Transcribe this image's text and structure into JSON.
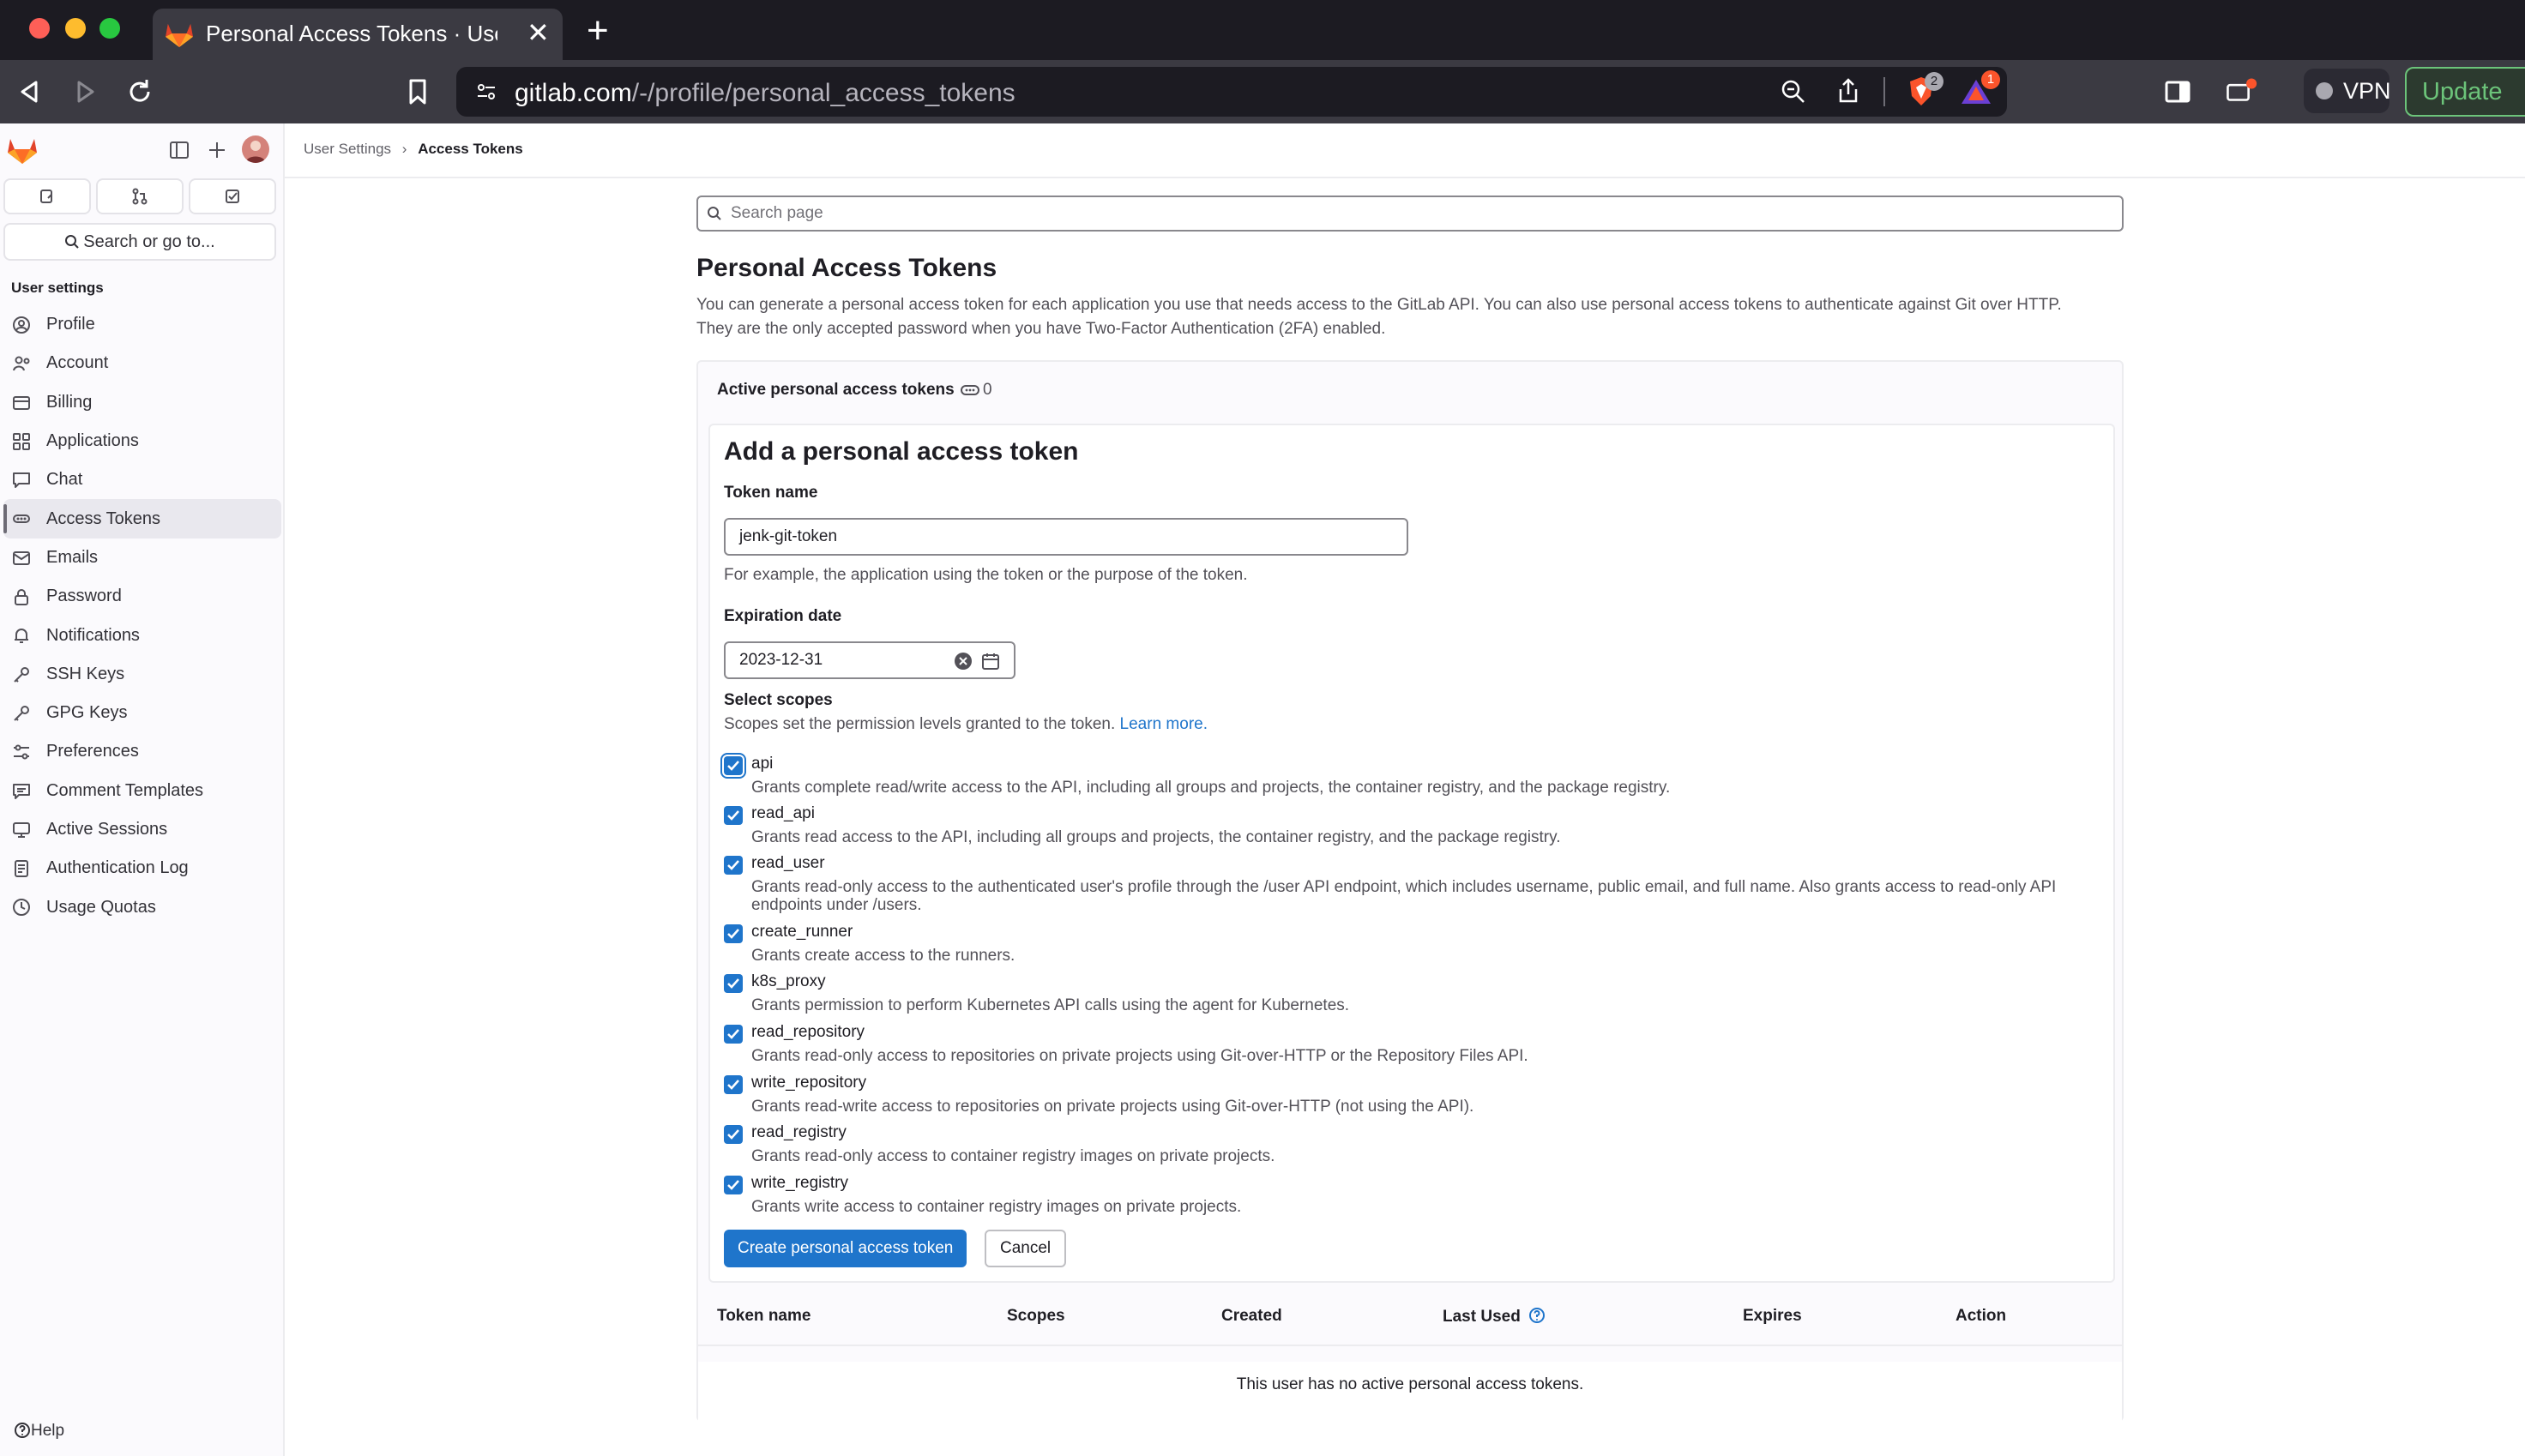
{
  "browser": {
    "tab_title": "Personal Access Tokens · User Settings · GitLab",
    "url_host": "gitlab.com",
    "url_path": "/-/profile/personal_access_tokens",
    "brave_badge": "2",
    "alert_badge": "1",
    "vpn_label": "VPN",
    "update_label": "Update"
  },
  "sidebar": {
    "section_title": "User settings",
    "search_label": "Search or go to...",
    "items": [
      {
        "label": "Profile",
        "icon": "profile-icon"
      },
      {
        "label": "Account",
        "icon": "account-icon"
      },
      {
        "label": "Billing",
        "icon": "billing-icon"
      },
      {
        "label": "Applications",
        "icon": "applications-icon"
      },
      {
        "label": "Chat",
        "icon": "chat-icon"
      },
      {
        "label": "Access Tokens",
        "icon": "token-icon"
      },
      {
        "label": "Emails",
        "icon": "email-icon"
      },
      {
        "label": "Password",
        "icon": "lock-icon"
      },
      {
        "label": "Notifications",
        "icon": "bell-icon"
      },
      {
        "label": "SSH Keys",
        "icon": "key-icon"
      },
      {
        "label": "GPG Keys",
        "icon": "key-icon"
      },
      {
        "label": "Preferences",
        "icon": "preferences-icon"
      },
      {
        "label": "Comment Templates",
        "icon": "comment-icon"
      },
      {
        "label": "Active Sessions",
        "icon": "monitor-icon"
      },
      {
        "label": "Authentication Log",
        "icon": "log-icon"
      },
      {
        "label": "Usage Quotas",
        "icon": "quota-icon"
      }
    ],
    "help_label": "Help"
  },
  "breadcrumb": {
    "parent": "User Settings",
    "separator": "›",
    "current": "Access Tokens"
  },
  "main": {
    "search_placeholder": "Search page",
    "title": "Personal Access Tokens",
    "description_1": "You can generate a personal access token for each application you use that needs access to the GitLab API. You can also use personal access tokens to authenticate against Git over HTTP.",
    "description_2": "They are the only accepted password when you have Two-Factor Authentication (2FA) enabled.",
    "active_tokens_label": "Active personal access tokens",
    "active_tokens_count": "0"
  },
  "form": {
    "title": "Add a personal access token",
    "token_name_label": "Token name",
    "token_name_value": "jenk-git-token",
    "token_name_help": "For example, the application using the token or the purpose of the token.",
    "expiration_label": "Expiration date",
    "expiration_value": "2023-12-31",
    "scopes_label": "Select scopes",
    "scopes_help": "Scopes set the permission levels granted to the token.",
    "learn_more": "Learn more.",
    "scopes": [
      {
        "name": "api",
        "desc": "Grants complete read/write access to the API, including all groups and projects, the container registry, and the package registry.",
        "checked": true
      },
      {
        "name": "read_api",
        "desc": "Grants read access to the API, including all groups and projects, the container registry, and the package registry.",
        "checked": true
      },
      {
        "name": "read_user",
        "desc": "Grants read-only access to the authenticated user's profile through the /user API endpoint, which includes username, public email, and full name. Also grants access to read-only API endpoints under /users.",
        "checked": true
      },
      {
        "name": "create_runner",
        "desc": "Grants create access to the runners.",
        "checked": true
      },
      {
        "name": "k8s_proxy",
        "desc": "Grants permission to perform Kubernetes API calls using the agent for Kubernetes.",
        "checked": true
      },
      {
        "name": "read_repository",
        "desc": "Grants read-only access to repositories on private projects using Git-over-HTTP or the Repository Files API.",
        "checked": true
      },
      {
        "name": "write_repository",
        "desc": "Grants read-write access to repositories on private projects using Git-over-HTTP (not using the API).",
        "checked": true
      },
      {
        "name": "read_registry",
        "desc": "Grants read-only access to container registry images on private projects.",
        "checked": true
      },
      {
        "name": "write_registry",
        "desc": "Grants write access to container registry images on private projects.",
        "checked": true
      }
    ],
    "create_button": "Create personal access token",
    "cancel_button": "Cancel"
  },
  "table": {
    "headers": [
      "Token name",
      "Scopes",
      "Created",
      "Last Used",
      "Expires",
      "Action"
    ],
    "empty_message": "This user has no active personal access tokens."
  },
  "colors": {
    "accent": "#1f75cb",
    "chrome_dark": "#1c1b22",
    "chrome_toolbar": "#3b3a42"
  }
}
